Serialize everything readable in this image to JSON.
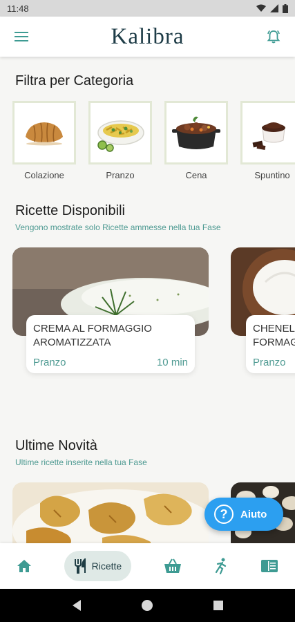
{
  "status_bar": {
    "time": "11:48",
    "icons": [
      "wifi-icon",
      "signal-icon",
      "battery-icon"
    ]
  },
  "app_bar": {
    "title": "Kalibra",
    "menu_icon": "menu-icon",
    "notification_icon": "bell-icon"
  },
  "categories": {
    "title": "Filtra per Categoria",
    "items": [
      {
        "label": "Colazione",
        "icon": "croissant-icon"
      },
      {
        "label": "Pranzo",
        "icon": "pasta-bowl-icon"
      },
      {
        "label": "Cena",
        "icon": "stew-pot-icon"
      },
      {
        "label": "Spuntino",
        "icon": "chocolate-cup-icon"
      }
    ]
  },
  "available": {
    "title": "Ricette Disponibili",
    "subtitle": "Vengono mostrate solo Ricette ammesse nella tua Fase",
    "cards": [
      {
        "title": "CREMA AL FORMAGGIO AROMATIZZATA",
        "category": "Pranzo",
        "time": "10 min"
      },
      {
        "title": "CHENEL FORMAG",
        "category": "Pranzo",
        "time": ""
      }
    ]
  },
  "latest": {
    "title": "Ultime Novità",
    "subtitle": "Ultime ricette inserite nella tua Fase"
  },
  "help_button": {
    "label": "Aiuto",
    "icon": "question-icon"
  },
  "bottom_nav": {
    "items": [
      {
        "icon": "home-icon",
        "label": ""
      },
      {
        "icon": "fork-knife-icon",
        "label": "Ricette",
        "active": true
      },
      {
        "icon": "basket-icon",
        "label": ""
      },
      {
        "icon": "running-person-icon",
        "label": ""
      },
      {
        "icon": "book-icon",
        "label": ""
      }
    ]
  },
  "colors": {
    "accent": "#4e9a92",
    "help": "#2c9ff0",
    "nav_active": "#dfe9e6",
    "title": "#1e3c47"
  }
}
